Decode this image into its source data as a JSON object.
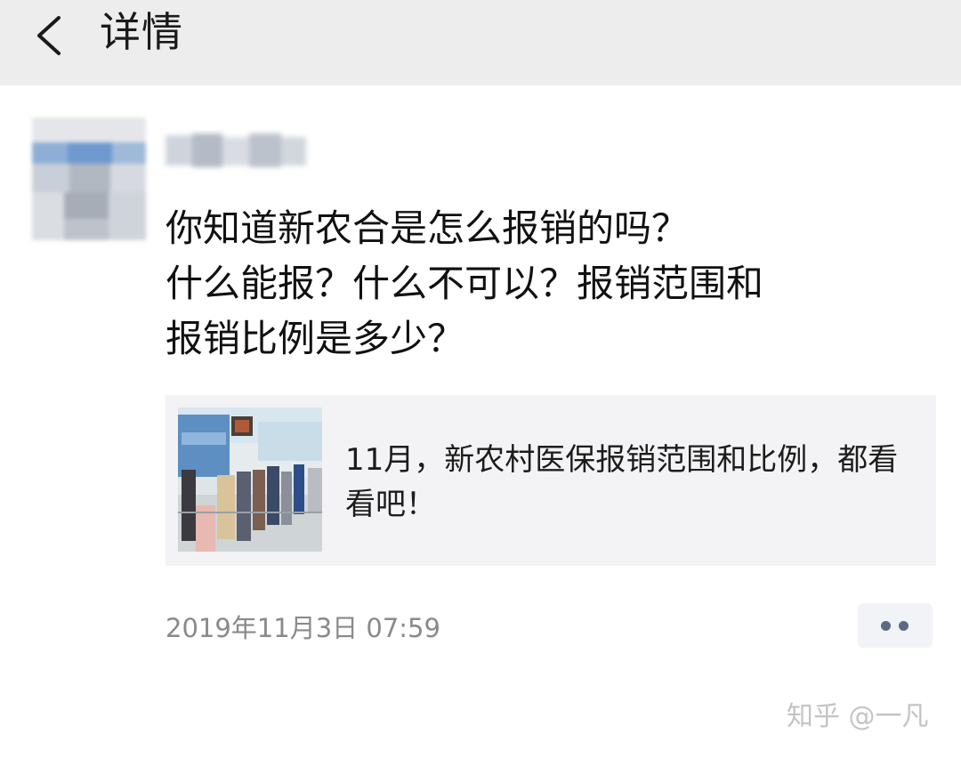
{
  "nav": {
    "back_icon": "chevron-left-icon",
    "title": "详情"
  },
  "post": {
    "lines": [
      "你知道新农合是怎么报销的吗？",
      "什么能报？什么不可以？报销范围和",
      "报销比例是多少？"
    ]
  },
  "link_card": {
    "title": "11月，新农村医保报销范围和比例，都看看吧！"
  },
  "timestamp": "2019年11月3日 07:59",
  "more_icon": "more-dots-icon",
  "watermark": "知乎 @一凡",
  "colors": {
    "nav_bg": "#ededed",
    "card_bg": "#f3f3f5",
    "timestamp": "#8a8a8a",
    "more_dot": "#5b6b86"
  }
}
